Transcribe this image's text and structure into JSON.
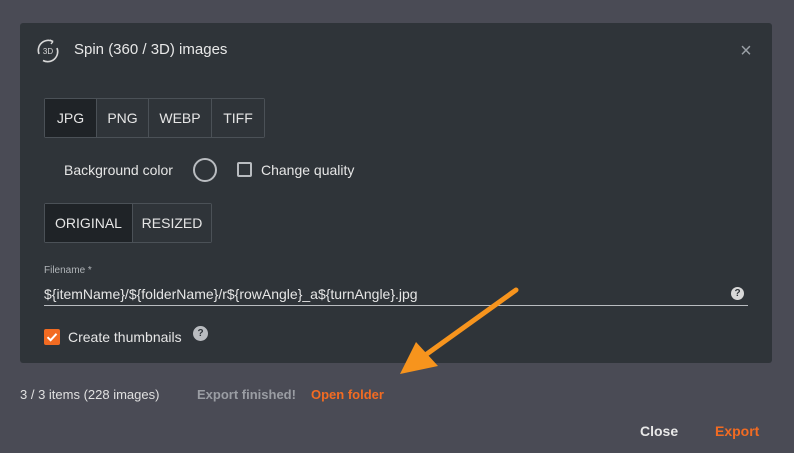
{
  "dialog": {
    "title": "Spin (360 / 3D) images",
    "icon_text": "3D",
    "close_glyph": "×"
  },
  "formats": [
    {
      "label": "JPG",
      "active": true
    },
    {
      "label": "PNG",
      "active": false
    },
    {
      "label": "WEBP",
      "active": false
    },
    {
      "label": "TIFF",
      "active": false
    }
  ],
  "background": {
    "label": "Background color"
  },
  "quality": {
    "label": "Change quality",
    "checked": false
  },
  "sizes": [
    {
      "label": "ORIGINAL",
      "active": true
    },
    {
      "label": "RESIZED",
      "active": false
    }
  ],
  "filename": {
    "label": "Filename *",
    "value": "${itemName}/${folderName}/r${rowAngle}_a${turnAngle}.jpg",
    "help": "?"
  },
  "thumbnails": {
    "label": "Create thumbnails",
    "checked": true,
    "help": "?"
  },
  "status": {
    "count": "3 / 3 items (228 images)",
    "message": "Export finished!",
    "open_folder": "Open folder"
  },
  "footer": {
    "close": "Close",
    "export": "Export"
  },
  "colors": {
    "accent": "#f26b22",
    "panel": "#2f3439",
    "backdrop": "#4a4b55",
    "arrow": "#f7941d"
  }
}
